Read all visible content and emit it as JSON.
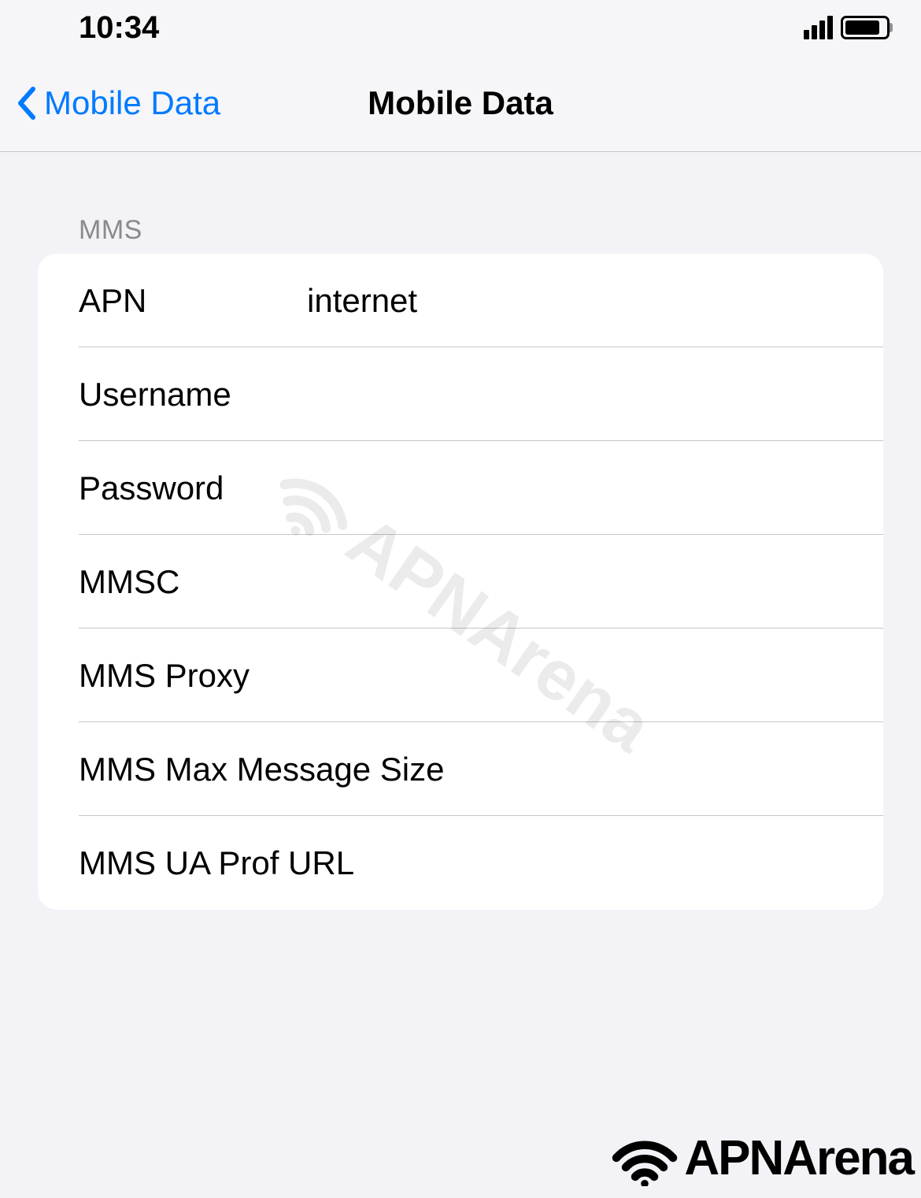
{
  "statusBar": {
    "time": "10:34"
  },
  "nav": {
    "backLabel": "Mobile Data",
    "title": "Mobile Data"
  },
  "section": {
    "header": "MMS",
    "rows": [
      {
        "label": "APN",
        "value": "internet"
      },
      {
        "label": "Username",
        "value": ""
      },
      {
        "label": "Password",
        "value": ""
      },
      {
        "label": "MMSC",
        "value": ""
      },
      {
        "label": "MMS Proxy",
        "value": ""
      },
      {
        "label": "MMS Max Message Size",
        "value": ""
      },
      {
        "label": "MMS UA Prof URL",
        "value": ""
      }
    ]
  },
  "watermark": "APNArena",
  "footerBrand": "APNArena"
}
